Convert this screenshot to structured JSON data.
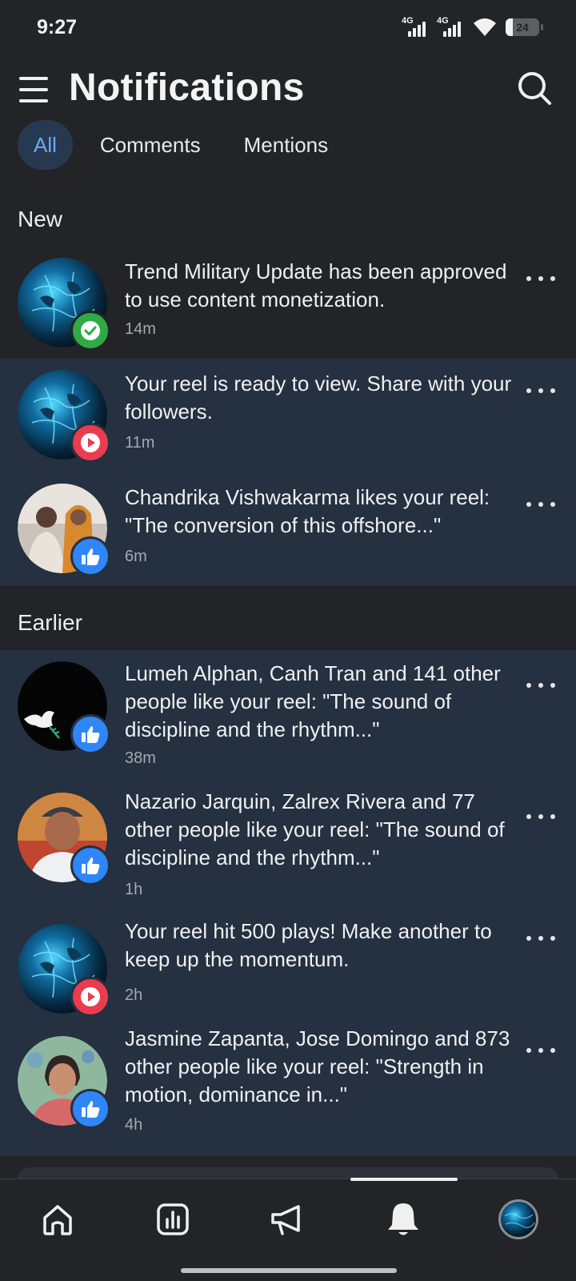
{
  "status_bar": {
    "time": "9:27",
    "network_1": "4G",
    "network_2": "4G",
    "battery": "24"
  },
  "header": {
    "title": "Notifications"
  },
  "tabs": [
    {
      "label": "All",
      "active": true
    },
    {
      "label": "Comments",
      "active": false
    },
    {
      "label": "Mentions",
      "active": false
    }
  ],
  "sections": {
    "new": "New",
    "earlier": "Earlier"
  },
  "notifications": [
    {
      "text": "Trend Military Update has been approved to use content monetization.",
      "time": "14m",
      "badge": "check-icon",
      "avatar": "globe"
    },
    {
      "text": "Your reel is ready to view. Share with your followers.",
      "time": "11m",
      "badge": "play-icon",
      "avatar": "globe"
    },
    {
      "text": "Chandrika Vishwakarma likes your reel: \"The conversion of this offshore...\"",
      "time": "6m",
      "badge": "like-icon",
      "avatar": "couple-photo"
    },
    {
      "text": "Lumeh Alphan, Canh Tran and 141 other people like your reel: \"The sound of discipline and the rhythm...\"",
      "time": "38m",
      "badge": "like-icon",
      "avatar": "dove"
    },
    {
      "text": "Nazario Jarquin, Zalrex Rivera and 77 other people like your reel: \"The sound of discipline and the rhythm...\"",
      "time": "1h",
      "badge": "like-icon",
      "avatar": "man-cap-photo"
    },
    {
      "text": "Your reel hit 500 plays! Make another to keep up the momentum.",
      "time": "2h",
      "badge": "play-icon",
      "avatar": "globe"
    },
    {
      "text": "Jasmine Zapanta, Jose Domingo and 873 other people like your reel: \"Strength in motion, dominance in...\"",
      "time": "4h",
      "badge": "like-icon",
      "avatar": "woman-photo"
    }
  ],
  "bottom_nav": [
    {
      "icon": "home-icon"
    },
    {
      "icon": "insights-icon"
    },
    {
      "icon": "megaphone-icon"
    },
    {
      "icon": "bell-icon",
      "active": true
    },
    {
      "icon": "profile-avatar"
    }
  ],
  "colors": {
    "background": "#232427",
    "unread": "#253040",
    "accent": "#6aa9f4",
    "like": "#2f86f6",
    "play": "#ea3c4f",
    "check": "#2eaa46"
  }
}
